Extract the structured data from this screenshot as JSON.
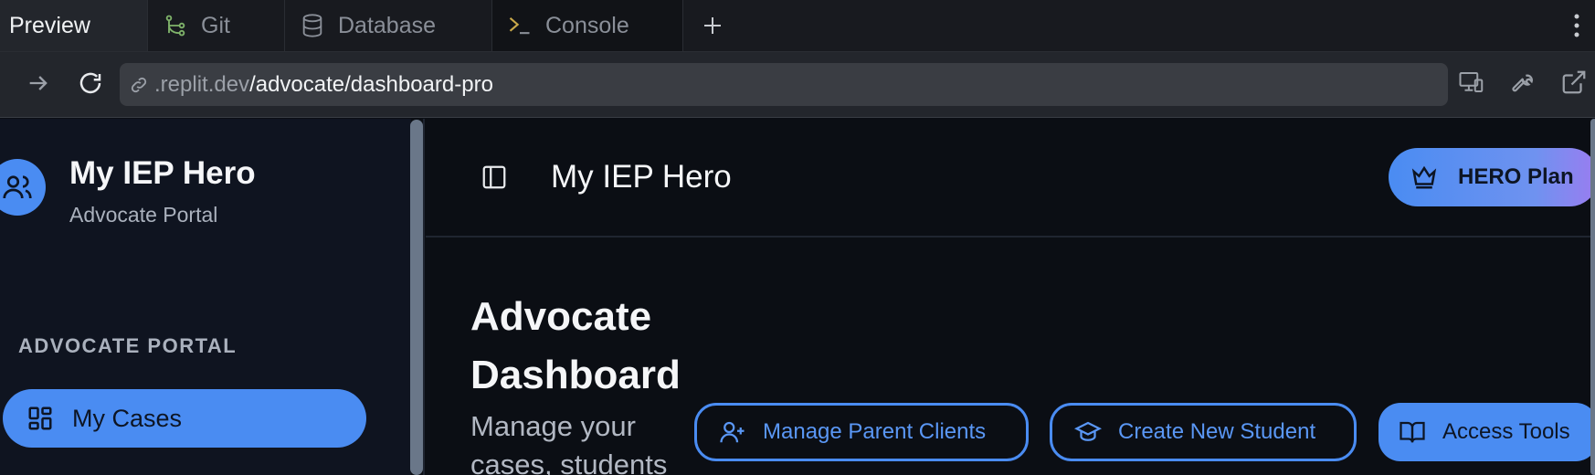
{
  "tabs": [
    {
      "label": "Preview",
      "icon": "none"
    },
    {
      "label": "Git",
      "icon": "git-branch-icon"
    },
    {
      "label": "Database",
      "icon": "database-icon"
    },
    {
      "label": "Console",
      "icon": "terminal-icon"
    }
  ],
  "url": {
    "domain": ".replit.dev",
    "path": "/advocate/dashboard-pro"
  },
  "sidebar": {
    "title": "My IEP Hero",
    "subtitle": "Advocate Portal",
    "section_label": "ADVOCATE PORTAL",
    "items": [
      {
        "label": "My Cases",
        "icon": "grid-icon"
      }
    ]
  },
  "header": {
    "title": "My IEP Hero",
    "plan_label": "HERO Plan"
  },
  "main": {
    "title": "Advocate Dashboard",
    "description": "Manage your cases, students",
    "actions": {
      "manage_parents": "Manage Parent Clients",
      "create_student": "Create New Student",
      "access_tools": "Access Tools"
    }
  },
  "colors": {
    "accent": "#4a8cf2",
    "background": "#0b0e14",
    "sidebar": "#0f1420",
    "gradient_end": "#9b7cf0"
  }
}
